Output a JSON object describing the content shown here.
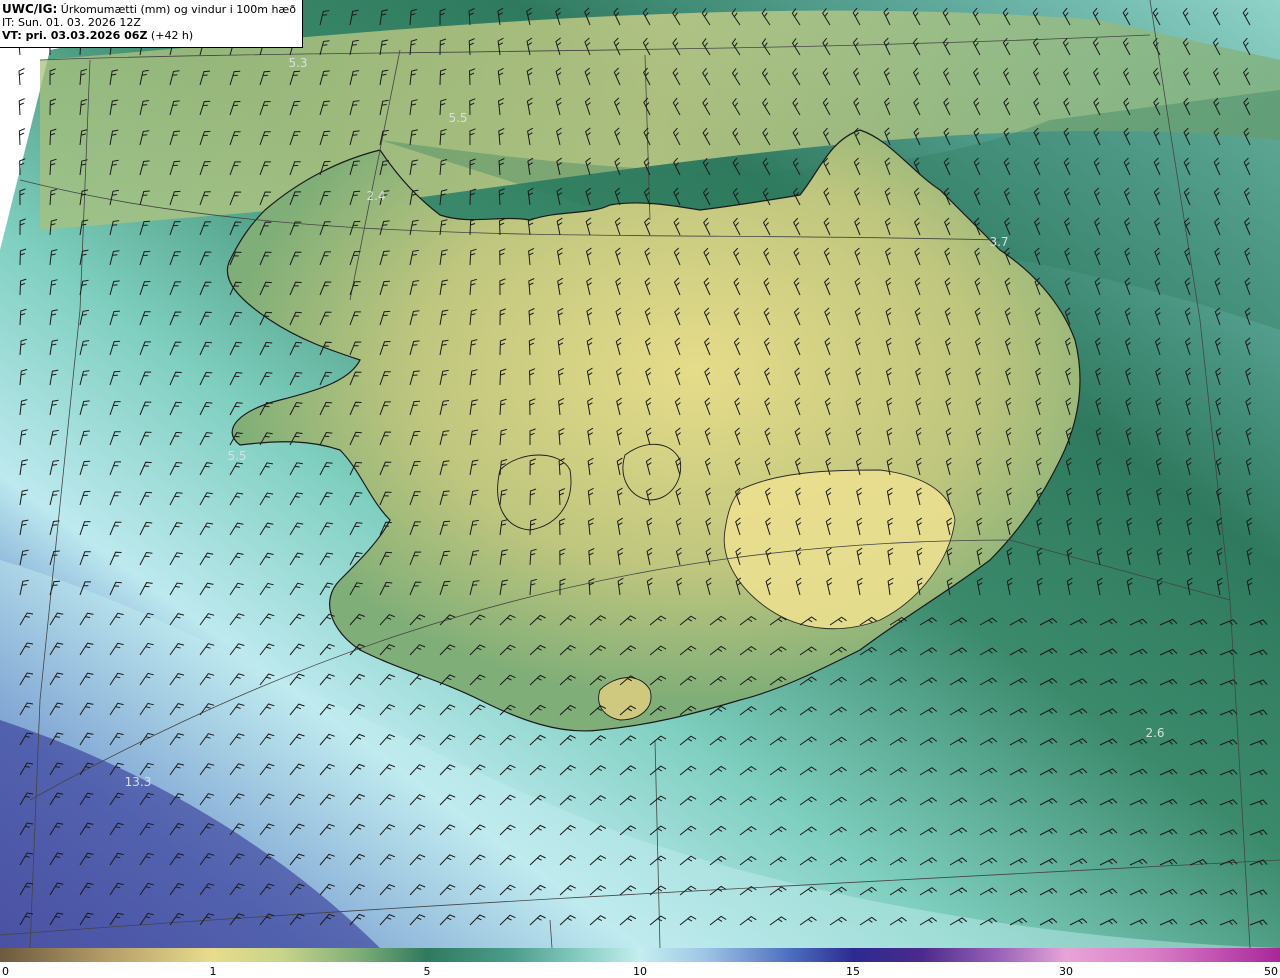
{
  "header": {
    "model": "UWC/IG:",
    "title": " Úrkomumætti (mm) og vindur i 100m hæð",
    "init_time": "IT: Sun. 01. 03. 2026 12Z",
    "valid_prefix": "VT: pri. 03.03.2026 06Z",
    "valid_offset": " (+42 h)"
  },
  "map_labels": [
    "5.3",
    "5.5",
    "2.4",
    "3.7",
    "5.5",
    "13.3",
    "2.6"
  ],
  "colorbar": {
    "ticks": [
      "0",
      "1",
      "5",
      "10",
      "15",
      "30",
      "50"
    ],
    "colors": {
      "low": "#6b5a3e",
      "mid": "#e8dc8c",
      "green": "#2f7a5e",
      "cyan": "#c4eef0",
      "blue": "#2c2a90",
      "magenta": "#a8269a"
    }
  }
}
